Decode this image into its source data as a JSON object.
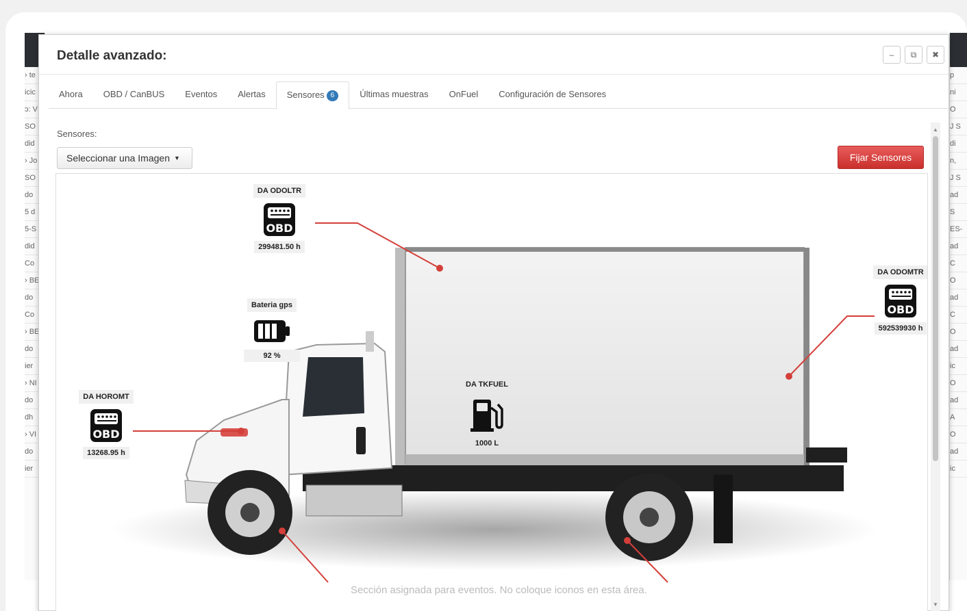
{
  "background_left": [
    "› te",
    "icic",
    "ɔ: V",
    "SO",
    "did",
    "› Jo",
    "SO",
    "do",
    "5 d",
    "5-S",
    "did",
    "Co",
    "› BE",
    "do",
    "Co",
    "› BE",
    "do",
    "ier",
    "› NI",
    "do",
    "dh",
    "› VI",
    "do",
    "ier"
  ],
  "background_right": [
    "p",
    "ni",
    "O",
    "J S",
    "di",
    "n,",
    "J S",
    "ad",
    "S",
    "ES-",
    "ad",
    "C",
    "O",
    "ad",
    "C",
    "O",
    "ad",
    "ic",
    "O",
    "ad",
    "A",
    "O",
    "ad",
    "ic"
  ],
  "modal": {
    "title": "Detalle avanzado:",
    "window_buttons": [
      "–",
      "⧉",
      "✖"
    ]
  },
  "tabs": [
    {
      "label": "Ahora"
    },
    {
      "label": "OBD / CanBUS"
    },
    {
      "label": "Eventos"
    },
    {
      "label": "Alertas"
    },
    {
      "label": "Sensores",
      "badge": "6",
      "active": true
    },
    {
      "label": "Últimas muestras"
    },
    {
      "label": "OnFuel"
    },
    {
      "label": "Configuración de Sensores"
    }
  ],
  "sensors_label": "Sensores:",
  "image_select": {
    "label": "Seleccionar una Imagen"
  },
  "fix_button": "Fijar Sensores",
  "sensors": [
    {
      "name": "DA ODOLTR",
      "icon": "obd-icon",
      "value": "299481.50 h"
    },
    {
      "name": "Bateria gps",
      "icon": "battery-icon",
      "value": "92 %",
      "level_percent": 92
    },
    {
      "name": "DA HOROMT",
      "icon": "obd-icon",
      "value": "13268.95 h"
    },
    {
      "name": "DA TKFUEL",
      "icon": "fuel-pump-icon",
      "value": "1000 L"
    },
    {
      "name": "DA ODOMTR",
      "icon": "obd-icon",
      "value": "592539930 h"
    }
  ],
  "footer_note": "Sección asignada para eventos. No coloque iconos en esta área.",
  "colors": {
    "accent": "#337ab7",
    "danger": "#d9534f",
    "connector": "#d43f3a"
  }
}
